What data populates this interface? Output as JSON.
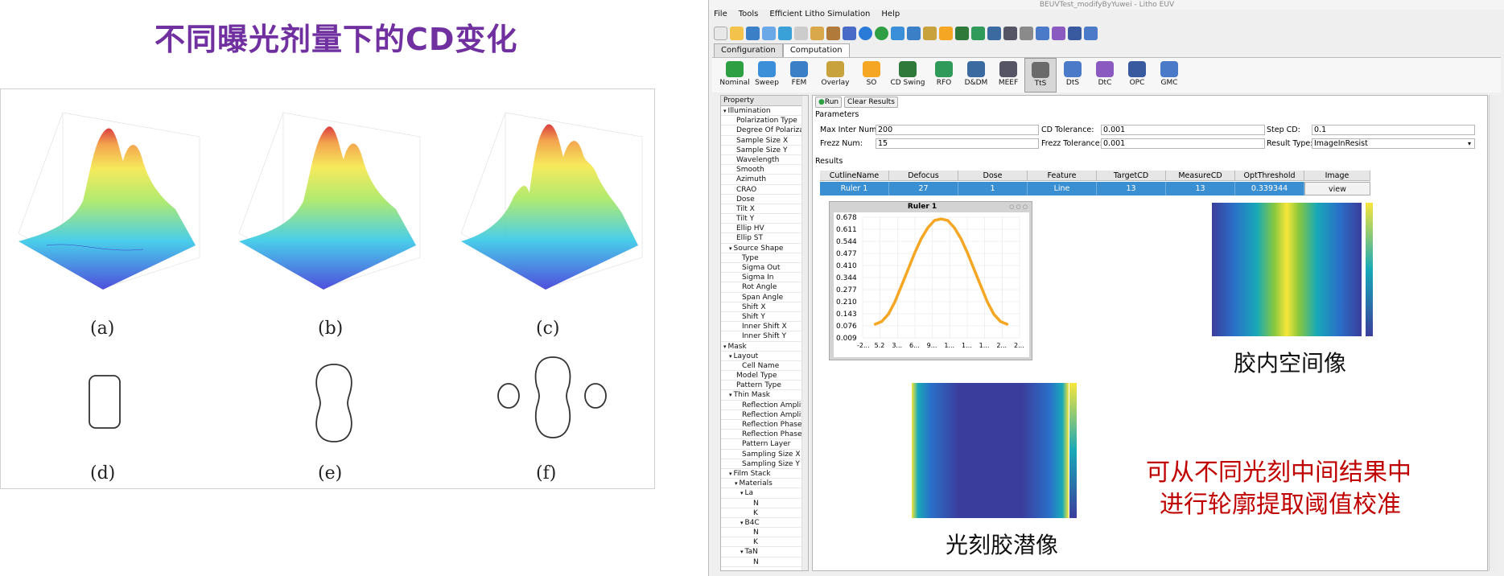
{
  "slide": {
    "title": "不同曝光剂量下的CD变化",
    "captions": [
      "(a)",
      "(b)",
      "(c)",
      "(d)",
      "(e)",
      "(f)"
    ]
  },
  "window": {
    "title": "BEUVTest_modifyByYuwei - Litho EUV"
  },
  "menu": [
    "File",
    "Tools",
    "Efficient Litho Simulation",
    "Help"
  ],
  "tabs": [
    {
      "label": "Configuration",
      "active": false
    },
    {
      "label": "Computation",
      "active": true
    }
  ],
  "ribbon": [
    {
      "label": "Nominal",
      "icon": "nominal-icon",
      "color": "#2ea043"
    },
    {
      "label": "Sweep",
      "icon": "sweep-icon",
      "color": "#3b8fd8"
    },
    {
      "label": "FEM",
      "icon": "fem-icon",
      "color": "#3b7fc6"
    },
    {
      "label": "Overlay",
      "icon": "overlay-icon",
      "color": "#c7a23d"
    },
    {
      "label": "SO",
      "icon": "so-icon",
      "color": "#f5a623"
    },
    {
      "label": "CD Swing",
      "icon": "cd-swing-icon",
      "color": "#2f7a3a"
    },
    {
      "label": "RFO",
      "icon": "rfo-icon",
      "color": "#2f9a5a"
    },
    {
      "label": "D&DM",
      "icon": "ddm-icon",
      "color": "#3a6aa0"
    },
    {
      "label": "MEEF",
      "icon": "meef-icon",
      "color": "#555566"
    },
    {
      "label": "TtS",
      "icon": "tts-icon",
      "color": "#6a6a6a"
    },
    {
      "label": "DtS",
      "icon": "dts-icon",
      "color": "#4a7ac8"
    },
    {
      "label": "DtC",
      "icon": "dtc-icon",
      "color": "#8a5ac0"
    },
    {
      "label": "OPC",
      "icon": "opc-icon",
      "color": "#3a5aa0"
    },
    {
      "label": "GMC",
      "icon": "gmc-icon",
      "color": "#4a7ac8"
    }
  ],
  "property_panel": {
    "header": "Property",
    "items": [
      {
        "label": "Illumination",
        "indent": 0,
        "expander": "▾"
      },
      {
        "label": "Polarization Type",
        "indent": 1,
        "expander": ""
      },
      {
        "label": "Degree Of Polarizat",
        "indent": 1,
        "expander": ""
      },
      {
        "label": "Sample Size X",
        "indent": 1,
        "expander": ""
      },
      {
        "label": "Sample Size Y",
        "indent": 1,
        "expander": ""
      },
      {
        "label": "Wavelength",
        "indent": 1,
        "expander": ""
      },
      {
        "label": "Smooth",
        "indent": 1,
        "expander": ""
      },
      {
        "label": "Azimuth",
        "indent": 1,
        "expander": ""
      },
      {
        "label": "CRAO",
        "indent": 1,
        "expander": ""
      },
      {
        "label": "Dose",
        "indent": 1,
        "expander": ""
      },
      {
        "label": "Tilt X",
        "indent": 1,
        "expander": ""
      },
      {
        "label": "Tilt Y",
        "indent": 1,
        "expander": ""
      },
      {
        "label": "Ellip HV",
        "indent": 1,
        "expander": ""
      },
      {
        "label": "Ellip ST",
        "indent": 1,
        "expander": ""
      },
      {
        "label": "Source Shape",
        "indent": 1,
        "expander": "▾"
      },
      {
        "label": "Type",
        "indent": 2,
        "expander": ""
      },
      {
        "label": "Sigma Out",
        "indent": 2,
        "expander": ""
      },
      {
        "label": "Sigma In",
        "indent": 2,
        "expander": ""
      },
      {
        "label": "Rot Angle",
        "indent": 2,
        "expander": ""
      },
      {
        "label": "Span Angle",
        "indent": 2,
        "expander": ""
      },
      {
        "label": "Shift X",
        "indent": 2,
        "expander": ""
      },
      {
        "label": "Shift Y",
        "indent": 2,
        "expander": ""
      },
      {
        "label": "Inner Shift X",
        "indent": 2,
        "expander": ""
      },
      {
        "label": "Inner Shift Y",
        "indent": 2,
        "expander": ""
      },
      {
        "label": "Mask",
        "indent": 0,
        "expander": "▾"
      },
      {
        "label": "Layout",
        "indent": 1,
        "expander": "▾"
      },
      {
        "label": "Cell Name",
        "indent": 2,
        "expander": ""
      },
      {
        "label": "Model Type",
        "indent": 1,
        "expander": ""
      },
      {
        "label": "Pattern Type",
        "indent": 1,
        "expander": ""
      },
      {
        "label": "Thin Mask",
        "indent": 1,
        "expander": "▾"
      },
      {
        "label": "Reflection Amplit",
        "indent": 2,
        "expander": ""
      },
      {
        "label": "Reflection Amplit",
        "indent": 2,
        "expander": ""
      },
      {
        "label": "Reflection Phase A",
        "indent": 2,
        "expander": ""
      },
      {
        "label": "Reflection Phase A",
        "indent": 2,
        "expander": ""
      },
      {
        "label": "Pattern Layer",
        "indent": 2,
        "expander": ""
      },
      {
        "label": "Sampling Size X",
        "indent": 2,
        "expander": ""
      },
      {
        "label": "Sampling Size Y",
        "indent": 2,
        "expander": ""
      },
      {
        "label": "Film Stack",
        "indent": 1,
        "expander": "▾"
      },
      {
        "label": "Materials",
        "indent": 2,
        "expander": "▾"
      },
      {
        "label": "La",
        "indent": 3,
        "expander": "▾"
      },
      {
        "label": "N",
        "indent": 4,
        "expander": ""
      },
      {
        "label": "K",
        "indent": 4,
        "expander": ""
      },
      {
        "label": "B4C",
        "indent": 3,
        "expander": "▾"
      },
      {
        "label": "N",
        "indent": 4,
        "expander": ""
      },
      {
        "label": "K",
        "indent": 4,
        "expander": ""
      },
      {
        "label": "TaN",
        "indent": 3,
        "expander": "▾"
      },
      {
        "label": "N",
        "indent": 4,
        "expander": ""
      }
    ]
  },
  "actions": {
    "run": "Run",
    "clear": "Clear Results"
  },
  "parameters": {
    "heading": "Parameters",
    "max_inter_num_label": "Max Inter Num:",
    "max_inter_num": "200",
    "cd_tolerance_label": "CD Tolerance:",
    "cd_tolerance": "0.001",
    "step_cd_label": "Step CD:",
    "step_cd": "0.1",
    "frezz_num_label": "Frezz Num:",
    "frezz_num": "15",
    "frezz_tolerance_label": "Frezz Tolerance:",
    "frezz_tolerance": "0.001",
    "result_type_label": "Result Type:",
    "result_type": "ImageInResist"
  },
  "results": {
    "heading": "Results",
    "columns": [
      "CutlineName",
      "Defocus",
      "Dose",
      "Feature",
      "TargetCD",
      "MeasureCD",
      "OptThreshold",
      "Image"
    ],
    "rows": [
      [
        "Ruler 1",
        "27",
        "1",
        "Line",
        "13",
        "13",
        "0.339344",
        "view"
      ]
    ]
  },
  "chart_window": {
    "title": "Ruler 1"
  },
  "chart_data": {
    "type": "line",
    "title": "",
    "xlabel": "",
    "ylabel": "",
    "yticks": [
      "0.678",
      "0.611",
      "0.544",
      "0.477",
      "0.410",
      "0.344",
      "0.277",
      "0.210",
      "0.143",
      "0.076",
      "0.009"
    ],
    "xticks": [
      "-2...",
      "5.2",
      "3...",
      "6...",
      "9...",
      "1...",
      "1...",
      "1...",
      "2...",
      "2..."
    ],
    "ylim": [
      0.009,
      0.678
    ],
    "grid": true,
    "series": [
      {
        "color": "#f5a623",
        "x": [
          0,
          1,
          2,
          3,
          4,
          5,
          6,
          7,
          8,
          9,
          10,
          11,
          12,
          13,
          14,
          15,
          16,
          17,
          18,
          19,
          20
        ],
        "values": [
          0.085,
          0.1,
          0.14,
          0.21,
          0.3,
          0.39,
          0.48,
          0.56,
          0.62,
          0.66,
          0.668,
          0.66,
          0.62,
          0.56,
          0.48,
          0.39,
          0.3,
          0.21,
          0.14,
          0.1,
          0.085
        ]
      }
    ]
  },
  "annotations": {
    "resist_image": "胶内空间像",
    "latent_image": "光刻胶潜像",
    "note_line1": "可从不同光刻中间结果中",
    "note_line2": "进行轮廓提取阈值校准"
  },
  "colors": {
    "title_purple": "#7030a0",
    "note_red": "#c00000",
    "selected_row": "#3a8fd2"
  }
}
